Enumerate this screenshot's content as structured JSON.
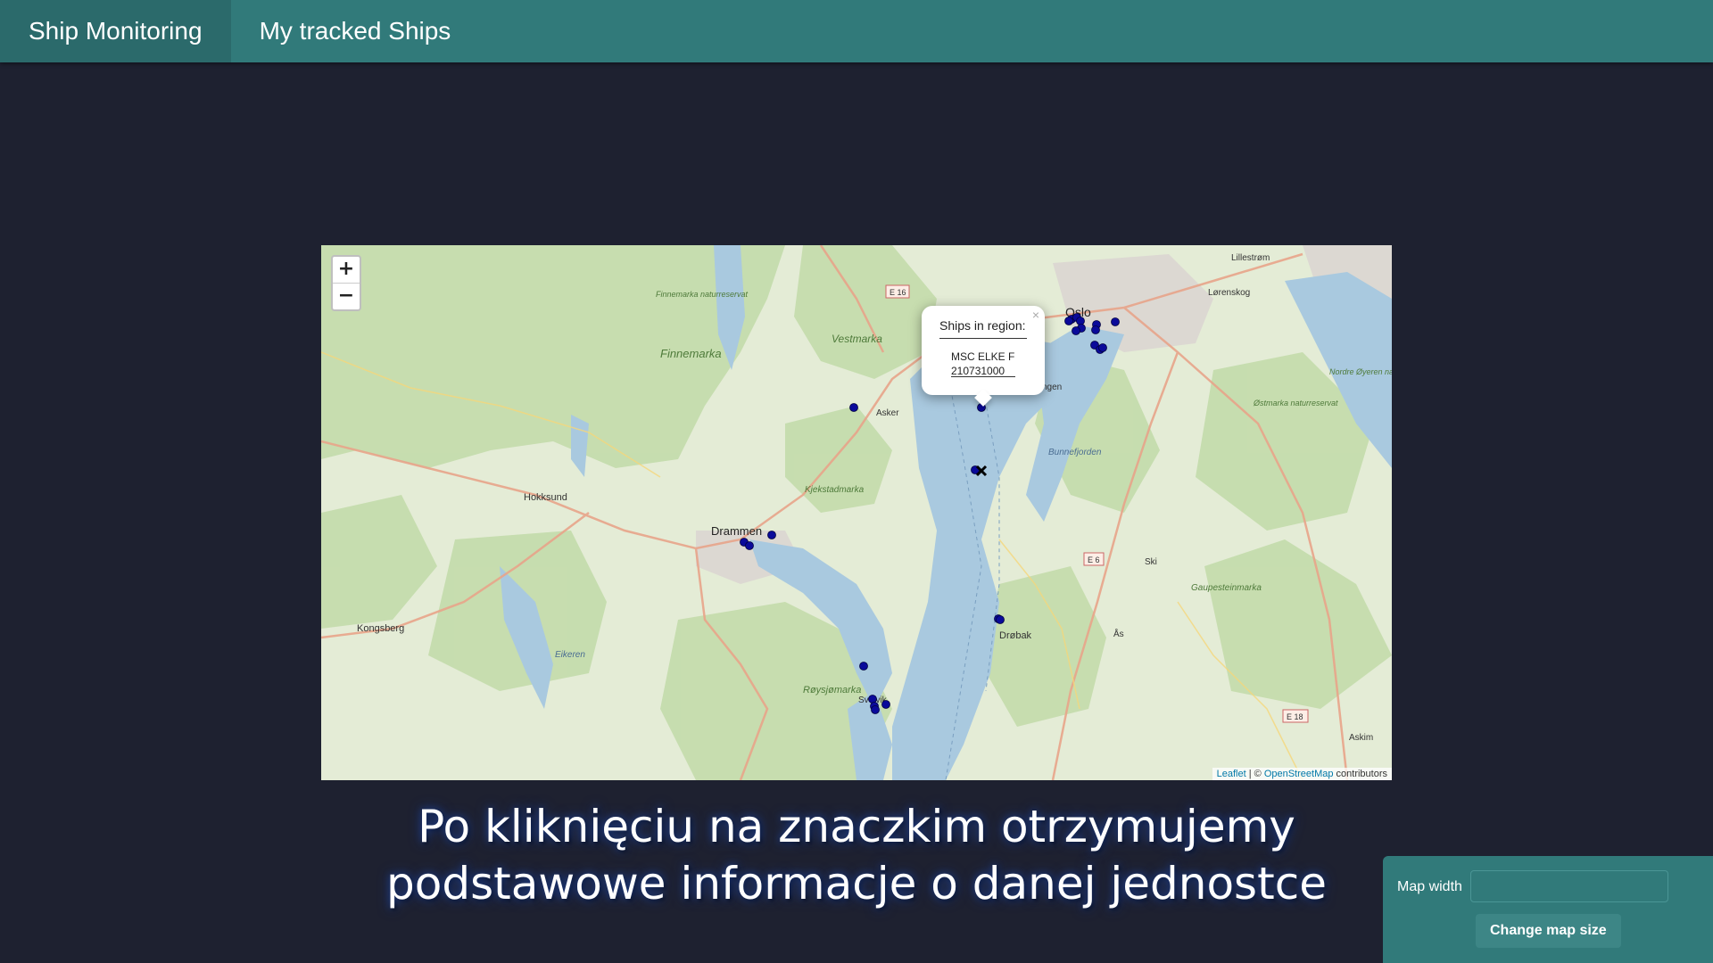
{
  "nav": {
    "items": [
      {
        "label": "Ship Monitoring",
        "active": true
      },
      {
        "label": "My tracked Ships",
        "active": false
      }
    ]
  },
  "map": {
    "zoom_in": "+",
    "zoom_out": "−",
    "popup": {
      "close": "×",
      "title": "Ships in region:",
      "ship_name": "MSC ELKE F",
      "ship_mmsi": "210731000"
    },
    "labels": {
      "oslo": "Oslo",
      "drammen": "Drammen",
      "hokksund": "Hokksund",
      "kongsberg": "Kongsberg",
      "finnemarka": "Finnemarka",
      "vestmarka": "Vestmarka",
      "kjekstadmarka": "Kjekstadmarka",
      "roysjomarka": "Røysjømarka",
      "drobak": "Drøbak",
      "asker": "Asker",
      "ski": "Ski",
      "as": "Ås",
      "lillestrom": "Lillestrøm",
      "lorenskog": "Lørenskog",
      "gaupesteinmarka": "Gaupesteinmarka",
      "ostmarka": "Østmarka naturreservat",
      "nordre": "Nordre Øyeren naturreservat",
      "bunnefjorden": "Bunnefjorden",
      "eikeren": "Eikeren",
      "askim": "Askim",
      "e16": "E 16",
      "e6": "E 6",
      "e18": "E 18",
      "finnemarka_nr": "Finnemarka naturreservat",
      "svelvik": "Svelvik",
      "nesodden_partial": "ngen"
    },
    "ship_marker_color": "#0a0a9a",
    "attribution": {
      "leaflet": "Leaflet",
      "separator": " | © ",
      "osm": "OpenStreetMap",
      "suffix": " contributors"
    }
  },
  "caption": {
    "line1": "Po kliknięciu na znaczkim otrzymujemy",
    "line2": "podstawowe informacje o danej jednostce"
  },
  "settings_panel": {
    "map_width_label": "Map width",
    "map_width_value": "",
    "button_label": "Change map size"
  }
}
